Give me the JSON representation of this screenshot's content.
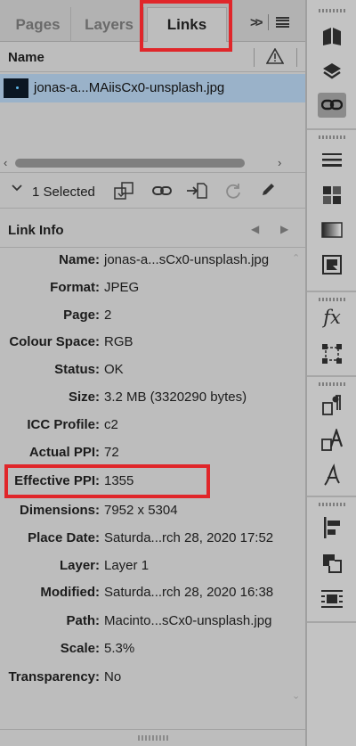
{
  "tabs": [
    {
      "label": "Pages"
    },
    {
      "label": "Layers"
    },
    {
      "label": "Links"
    }
  ],
  "tab_menu": {
    "overflow": ">>"
  },
  "list_header": {
    "name": "Name"
  },
  "selected_link": {
    "filename": "jonas-a...MAiisCx0-unsplash.jpg"
  },
  "selection": {
    "label": "1 Selected"
  },
  "link_info": {
    "title": "Link Info",
    "rows": [
      {
        "label": "Name:",
        "value": "jonas-a...sCx0-unsplash.jpg"
      },
      {
        "label": "Format:",
        "value": "JPEG"
      },
      {
        "label": "Page:",
        "value": "2"
      },
      {
        "label": "Colour Space:",
        "value": "RGB"
      },
      {
        "label": "Status:",
        "value": "OK"
      },
      {
        "label": "Size:",
        "value": "3.2 MB (3320290 bytes)"
      },
      {
        "label": "ICC Profile:",
        "value": "c2"
      },
      {
        "label": "Actual PPI:",
        "value": "72"
      },
      {
        "label": "Effective PPI:",
        "value": "1355"
      },
      {
        "label": "Dimensions:",
        "value": "7952 x 5304"
      },
      {
        "label": "Place Date:",
        "value": "Saturda...rch 28, 2020 17:52"
      },
      {
        "label": "Layer:",
        "value": "Layer 1"
      },
      {
        "label": "Modified:",
        "value": "Saturda...rch 28, 2020 16:38"
      },
      {
        "label": "Path:",
        "value": "Macinto...sCx0-unsplash.jpg"
      },
      {
        "label": "Scale:",
        "value": "5.3%"
      },
      {
        "label": "Transparency:",
        "value": "No"
      }
    ]
  },
  "right_toolbar": {
    "fx_label": "fx",
    "icons": [
      "pages-icon",
      "layers-icon",
      "links-icon",
      "stroke-icon",
      "swatches-icon",
      "gradient-icon",
      "color-icon",
      "effects-icon",
      "transform-icon",
      "paragraph-styles-icon",
      "character-styles-icon",
      "glyphs-icon",
      "align-icon",
      "pathfinder-icon",
      "text-wrap-icon"
    ]
  },
  "colors": {
    "highlight": "#e0262a",
    "selected_row": "#9ab2c9",
    "panel": "#bdbdbd"
  }
}
